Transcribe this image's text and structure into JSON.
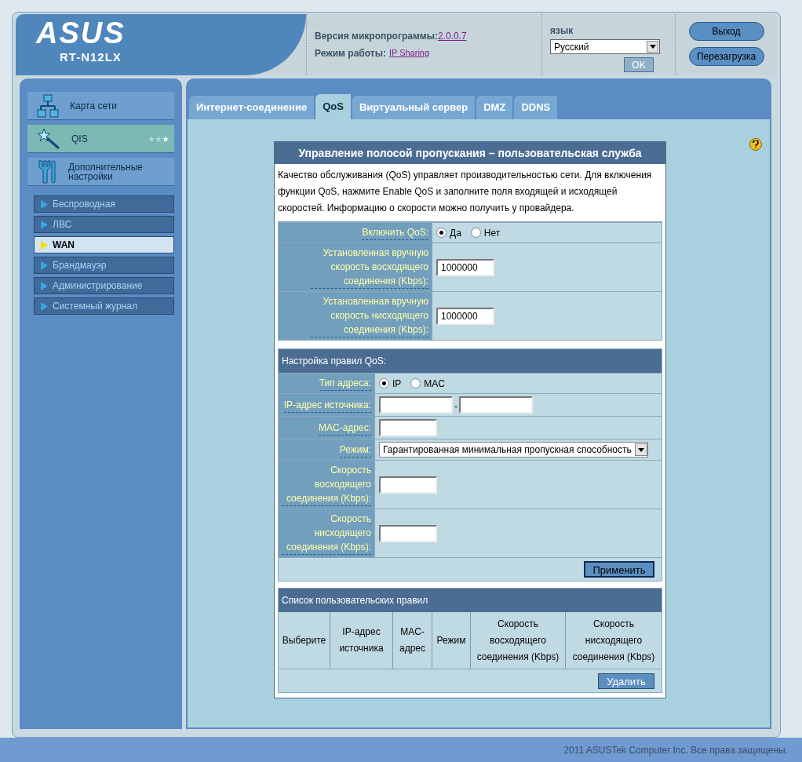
{
  "header": {
    "logo": "ASUS",
    "model": "RT-N12LX",
    "firmware_label": "Версия микропрограммы:",
    "firmware_value": "2.0.0.7",
    "mode_label": "Режим работы:",
    "mode_value": "IP Sharing",
    "language_label": "язык",
    "language_value": "Русский",
    "ok_button": "OK",
    "logout_button": "Выход",
    "reboot_button": "Перезагрузка"
  },
  "sidebar": {
    "main_items": [
      {
        "label": "Карта сети",
        "kind": "network",
        "selected": false
      },
      {
        "label": "QIS",
        "kind": "wizard",
        "selected": true
      },
      {
        "label": "Дополнительные настройки",
        "kind": "tools",
        "selected": false
      }
    ],
    "sub_items": [
      {
        "label": "Беспроводная",
        "selected": false
      },
      {
        "label": "ЛВС",
        "selected": false
      },
      {
        "label": "WAN",
        "selected": true
      },
      {
        "label": "Брандмауэр",
        "selected": false
      },
      {
        "label": "Администрирование",
        "selected": false
      },
      {
        "label": "Системный журнал",
        "selected": false
      }
    ]
  },
  "tabs": [
    {
      "label": "Интернет-соединение",
      "selected": false
    },
    {
      "label": "QoS",
      "selected": true
    },
    {
      "label": "Виртуальный сервер",
      "selected": false
    },
    {
      "label": "DMZ",
      "selected": false
    },
    {
      "label": "DDNS",
      "selected": false
    }
  ],
  "panel": {
    "title": "Управление полосой пропускания – пользовательская служба",
    "description": "Качество обслуживания (QoS) управляет производительностью сети. Для включения функции QoS, нажмите Enable QoS и заполните поля входящей и исходящей скоростей. Информацию о скорости можно получить у провайдера.",
    "settings": [
      {
        "kind": "radio",
        "label": "Включить QoS:",
        "options": [
          {
            "label": "Да",
            "selected": true
          },
          {
            "label": "Нет",
            "selected": false
          }
        ]
      },
      {
        "kind": "input",
        "label": "Установленная вручную скорость восходящего соединения (Kbps):",
        "value": "1000000"
      },
      {
        "kind": "input",
        "label": "Установленная вручную скорость нисходящего соединения (Kbps):",
        "value": "1000000"
      }
    ],
    "rules": {
      "title": "Настройка правил QoS:",
      "rows": [
        {
          "kind": "radio",
          "label": "Тип адреса:",
          "options": [
            {
              "label": "IP",
              "selected": true
            },
            {
              "label": "MAC",
              "selected": false
            }
          ]
        },
        {
          "kind": "range",
          "label": "IP-адрес источника:",
          "separator": "-"
        },
        {
          "kind": "input",
          "label": "MAC-адрес:"
        },
        {
          "kind": "select",
          "label": "Режим:",
          "value": "Гарантированная минимальная пропускная способность"
        },
        {
          "kind": "input",
          "label": "Скорость восходящего соединения (Kbps):"
        },
        {
          "kind": "input",
          "label": "Скорость нисходящего соединения (Kbps):"
        }
      ],
      "apply_button": "Применить"
    },
    "list": {
      "title": "Список пользовательских правил",
      "columns": [
        "Выберите",
        "IP-адрес источника",
        "MAC-адрес",
        "Режим",
        "Скорость восходящего соединения (Kbps)",
        "Скорость нисходящего соединения (Kbps)"
      ],
      "delete_button": "Удалить"
    }
  },
  "footer": {
    "copyright": "2011 ASUSTek Computer Inc. Все права защищены."
  }
}
